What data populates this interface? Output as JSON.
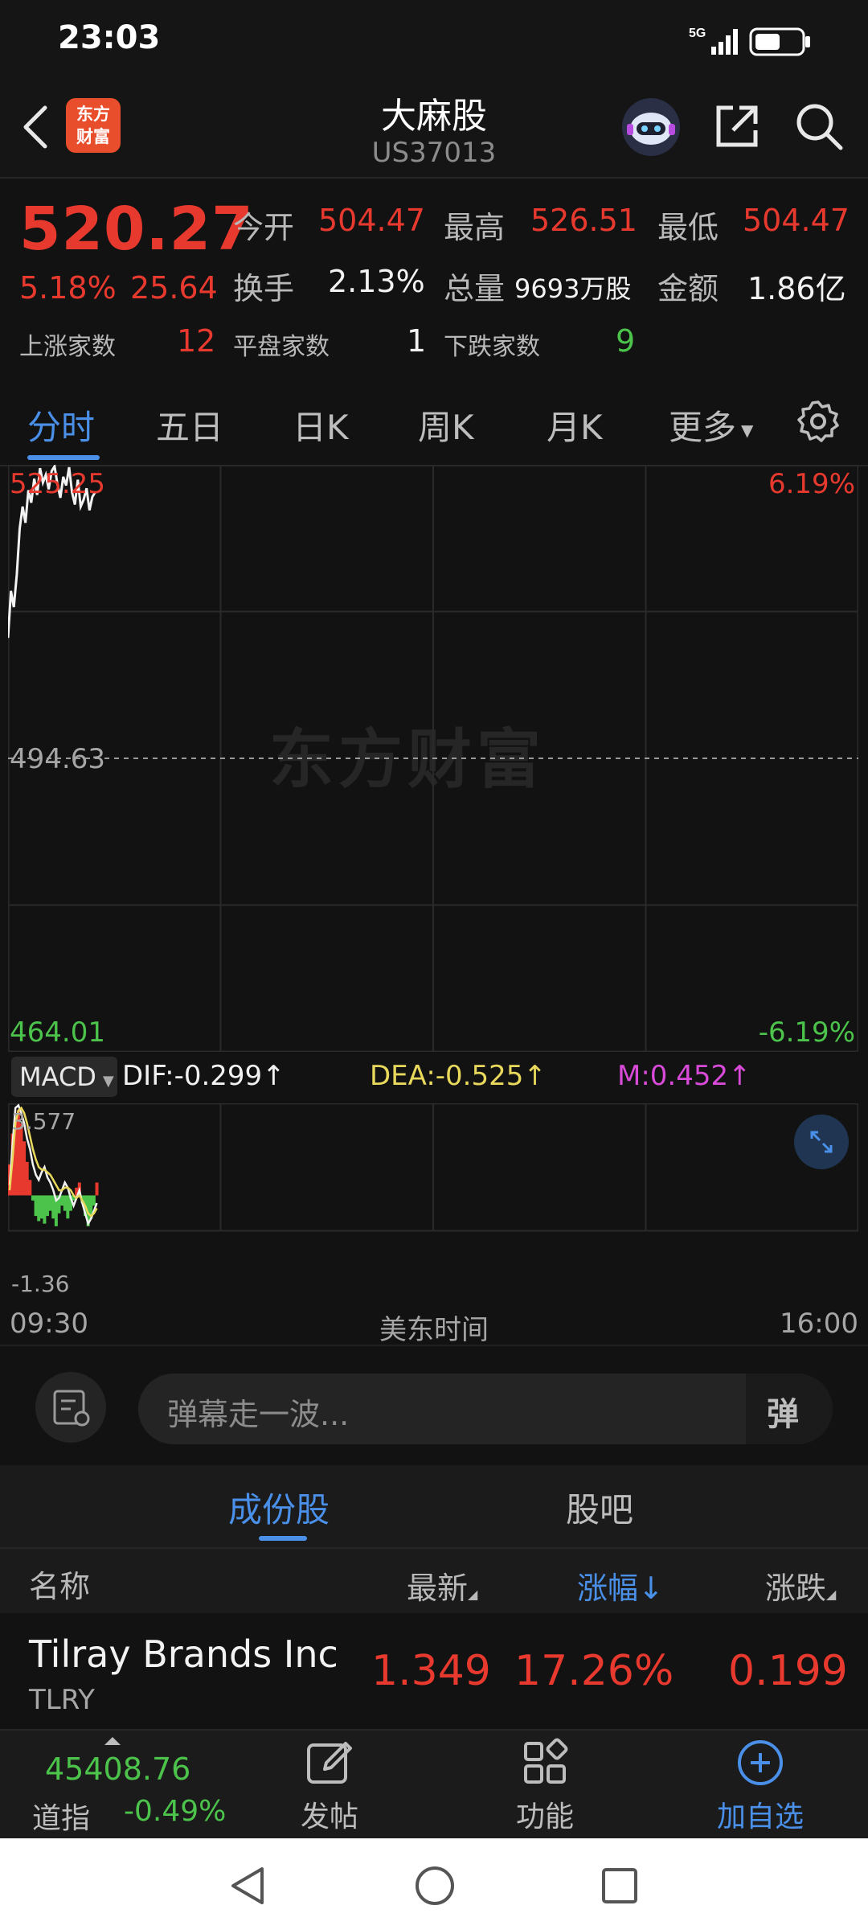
{
  "status": {
    "time": "23:03",
    "network": "5G"
  },
  "header": {
    "title": "大麻股",
    "code": "US37013",
    "logo_text": "东方财富"
  },
  "quote": {
    "price": "520.27",
    "change_pct": "5.18%",
    "change": "25.64",
    "open_label": "今开",
    "open": "504.47",
    "high_label": "最高",
    "high": "526.51",
    "low_label": "最低",
    "low": "504.47",
    "turnover_label": "换手",
    "turnover": "2.13%",
    "volume_label": "总量",
    "volume": "9693万股",
    "amount_label": "金额",
    "amount": "1.86亿",
    "up_label": "上涨家数",
    "up": "12",
    "flat_label": "平盘家数",
    "flat": "1",
    "down_label": "下跌家数",
    "down": "9"
  },
  "tabs": [
    "分时",
    "五日",
    "日K",
    "周K",
    "月K",
    "更多"
  ],
  "chart": {
    "top_price": "525.25",
    "mid_price": "494.63",
    "bottom_price": "464.01",
    "top_pct": "6.19%",
    "bottom_pct": "-6.19%",
    "watermark": "东方财富",
    "time_start": "09:30",
    "time_mid": "美东时间",
    "time_end": "16:00",
    "colors": {
      "up": "#e8392f",
      "down": "#4cc34b",
      "line": "#f2f2f2",
      "dea": "#e8d85c",
      "m": "#d84ad8"
    }
  },
  "chart_data": {
    "type": "line",
    "ylim": [
      464.01,
      525.25
    ],
    "prev_close": 494.63,
    "series": [
      {
        "values": [
          507.2,
          512.1,
          510.4,
          513.8,
          518.6,
          520.9,
          519.2,
          522.6,
          521.3,
          523.8,
          522.1,
          524.9,
          523.4,
          524.2,
          522.7,
          524.6,
          525.1,
          523.2,
          521.8,
          524.0,
          523.1,
          525.0,
          522.4,
          521.1,
          523.7,
          520.9,
          521.6,
          522.8,
          520.5,
          521.9,
          522.4
        ]
      }
    ]
  },
  "macd": {
    "selector": "MACD",
    "dif": "DIF:-0.299",
    "dea": "DEA:-0.525",
    "m": "M:0.452",
    "top": "3.577",
    "bottom": "-1.36",
    "hist": [
      1.2,
      2.4,
      3.0,
      3.3,
      2.8,
      2.1,
      1.3,
      0.6,
      -0.2,
      -0.8,
      -1.0,
      -0.9,
      -1.1,
      -0.8,
      -0.6,
      -0.9,
      -1.2,
      -0.7,
      -0.4,
      -0.6,
      -0.9,
      -0.6,
      -0.2,
      0.3,
      0.5,
      -0.3,
      -0.8,
      -1.2,
      -0.9,
      -0.4,
      0.5
    ],
    "dif_line": [
      0.4,
      2.0,
      3.4,
      3.5,
      3.2,
      2.8,
      2.2,
      1.8,
      1.2,
      0.8,
      0.6,
      0.9,
      1.1,
      0.7,
      0.5,
      0.2,
      -0.2,
      -0.1,
      0.2,
      0.5,
      0.3,
      -0.1,
      -0.4,
      -0.1,
      0.2,
      -0.3,
      -0.7,
      -1.1,
      -0.9,
      -0.6,
      -0.3
    ],
    "dea_line": [
      0.2,
      1.4,
      2.8,
      3.3,
      3.4,
      3.2,
      2.8,
      2.3,
      1.8,
      1.4,
      1.1,
      1.0,
      1.0,
      0.9,
      0.8,
      0.6,
      0.4,
      0.2,
      0.2,
      0.3,
      0.3,
      0.2,
      0.0,
      -0.1,
      0.0,
      -0.2,
      -0.4,
      -0.7,
      -0.8,
      -0.7,
      -0.5
    ]
  },
  "danmaku": {
    "placeholder": "弹幕走一波...",
    "send_label": "弹"
  },
  "components": {
    "tab_active": "成份股",
    "tab_other": "股吧",
    "col_name": "名称",
    "col_latest": "最新",
    "col_pct": "涨幅",
    "col_change": "涨跌",
    "rows": [
      {
        "name": "Tilray Brands Inc",
        "ticker": "TLRY",
        "latest": "1.349",
        "pct": "17.26%",
        "change": "0.199"
      }
    ]
  },
  "bottomnav": {
    "index_value": "45408.76",
    "index_name": "道指",
    "index_pct": "-0.49%",
    "post": "发帖",
    "func": "功能",
    "add": "加自选"
  }
}
